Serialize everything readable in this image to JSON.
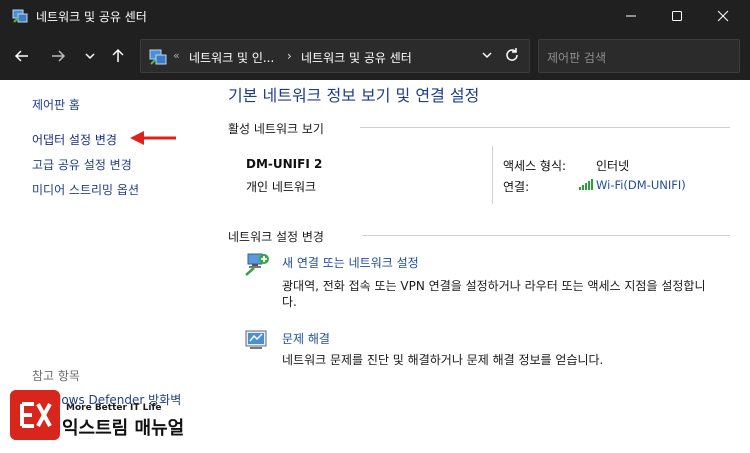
{
  "window": {
    "title": "네트워크 및 공유 센터"
  },
  "nav": {
    "breadcrumb_prefix": "«",
    "breadcrumb_1": "네트워크 및 인...",
    "breadcrumb_sep": "›",
    "breadcrumb_2": "네트워크 및 공유 센터",
    "search_placeholder": "제어판 검색"
  },
  "sidebar": {
    "home": "제어판 홈",
    "adapter": "어댑터 설정 변경",
    "advanced_sharing": "고급 공유 설정 변경",
    "media_streaming": "미디어 스트리밍 옵션",
    "see_also": "참고 항목",
    "defender": "lows Defender 방화벽"
  },
  "main": {
    "title": "기본 네트워크 정보 보기 및 연결 설정",
    "active_section": "활성 네트워크 보기",
    "network_name": "DM-UNIFI 2",
    "network_type": "개인 네트워크",
    "access_label": "액세스 형식:",
    "access_value": "인터넷",
    "conn_label": "연결:",
    "conn_value": "Wi-Fi(DM-UNIFI)",
    "change_section": "네트워크 설정 변경",
    "option1_title": "새 연결 또는 네트워크 설정",
    "option1_desc_a": "광대역, 전화 접속 또는 VPN 연결을 설정하거나 라우터 또는 액세스 지점을 설정합니",
    "option1_desc_b": "다.",
    "option2_title": "문제 해결",
    "option2_desc": "네트워크 문제를 진단 및 해결하거나 문제 해결 정보를 얻습니다."
  },
  "watermark": {
    "tagline": "More Better IT Life",
    "name": "익스트림 매뉴얼"
  },
  "colors": {
    "link": "#1e3e8a",
    "titlebar": "#202020",
    "arrow": "#e0201b",
    "watermark": "#d9261c"
  }
}
